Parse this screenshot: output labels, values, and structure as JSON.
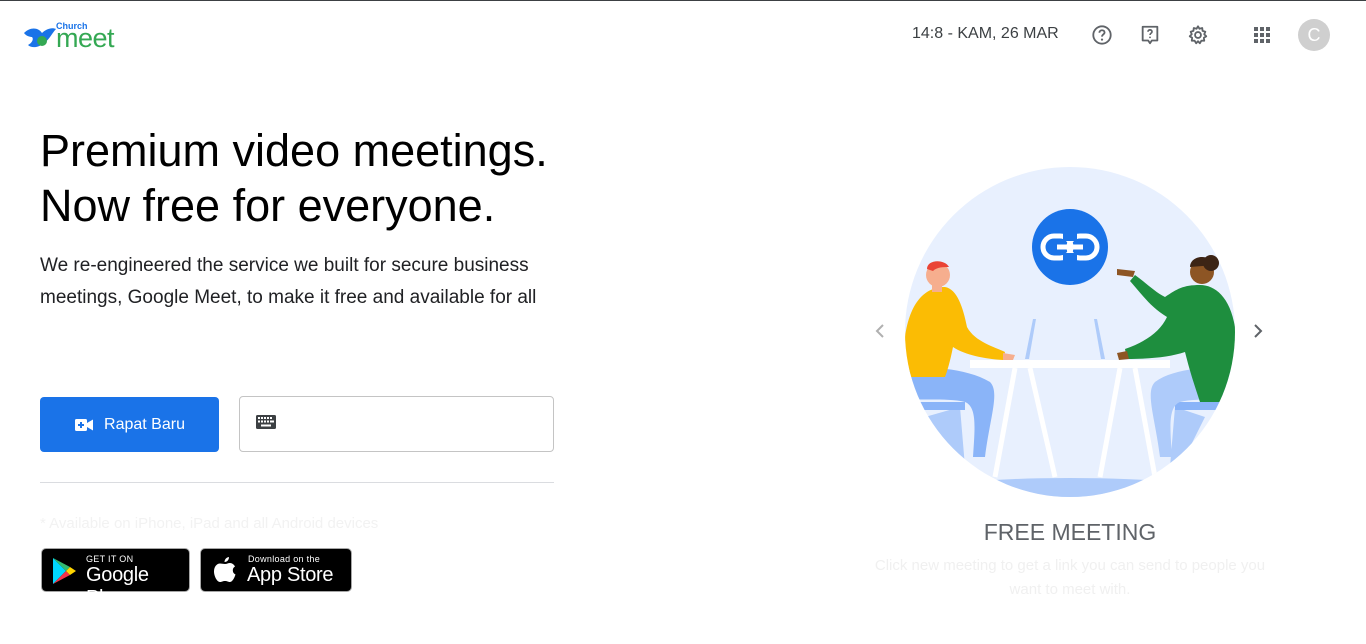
{
  "header": {
    "logo_small": "Church",
    "logo_big": "meet",
    "datetime": "14:8 - KAM, 26 MAR",
    "icons": [
      "help-icon",
      "feedback-icon",
      "settings-icon",
      "apps-grid-icon"
    ],
    "avatar_letter": "C"
  },
  "hero": {
    "headline_line1": "Premium video meetings.",
    "headline_line2": "Now free for everyone.",
    "subtext": "We re-engineered the service we built for secure business meetings, Google Meet, to make it free and available for all",
    "new_meeting_label": "Rapat Baru",
    "code_input_value": "",
    "code_input_placeholder": "",
    "availability_note": "* Available on iPhone, iPad and all Android devices"
  },
  "stores": {
    "google_play_small": "GET IT ON",
    "google_play_big": "Google Play",
    "app_store_small": "Download on the",
    "app_store_big": "App Store"
  },
  "carousel": {
    "title": "FREE MEETING",
    "description": "Click new meeting to get a link you can send to people you want to meet with."
  },
  "colors": {
    "primary": "#1a73e8",
    "logo_green": "#34a853",
    "illustration_bg": "#e8f0fe",
    "person_left_shirt": "#fbbc04",
    "person_right_shirt": "#1e8e3e"
  }
}
